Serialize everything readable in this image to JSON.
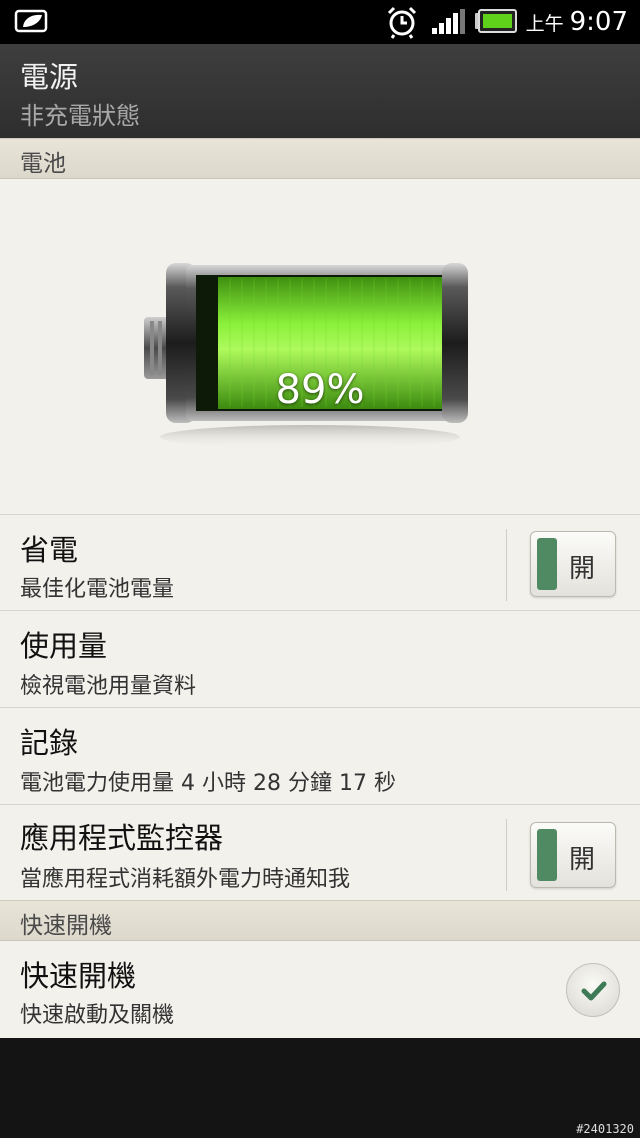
{
  "status_bar": {
    "ampm": "上午",
    "time": "9:07",
    "icons": [
      "power-saver-leaf-icon",
      "alarm-clock-icon",
      "signal-strength-icon",
      "battery-icon"
    ]
  },
  "header": {
    "title": "電源",
    "subtitle": "非充電狀態"
  },
  "battery_section": {
    "header": "電池",
    "percent_label": "89%",
    "level_percent": 89
  },
  "settings": [
    {
      "title": "省電",
      "subtitle": "最佳化電池電量",
      "toggle": "開"
    },
    {
      "title": "使用量",
      "subtitle": "檢視電池用量資料"
    },
    {
      "title": "記錄",
      "subtitle": "電池電力使用量 4 小時 28 分鐘 17 秒"
    },
    {
      "title": "應用程式監控器",
      "subtitle": "當應用程式消耗額外電力時通知我",
      "toggle": "開"
    }
  ],
  "fast_boot_section": {
    "header": "快速開機",
    "title": "快速開機",
    "subtitle": "快速啟動及關機",
    "checked": true
  },
  "watermark": "#2401320",
  "colors": {
    "battery_green": "#7be22a",
    "toggle_on": "#4f8a63",
    "check": "#3d7a55"
  }
}
